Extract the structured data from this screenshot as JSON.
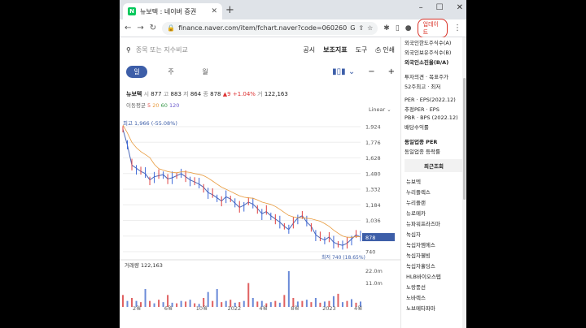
{
  "browser": {
    "tab_title": "뉴보텍 : 네이버 증권",
    "tab_favicon": "N",
    "url": "finance.naver.com/item/fchart.naver?code=060260",
    "update_label": "업데이트"
  },
  "search": {
    "placeholder": "종목 또는 지수비교"
  },
  "menu": [
    "공시",
    "보조지표",
    "도구",
    "인쇄"
  ],
  "periods": [
    "일",
    "주",
    "월"
  ],
  "quote": {
    "name": "뉴보텍",
    "open_label": "시",
    "open": "877",
    "high_label": "고",
    "high": "883",
    "low_label": "저",
    "low": "864",
    "close_label": "종",
    "close": "878",
    "change": "▲9",
    "change_pct": "+1.04%",
    "volume_label": "거",
    "volume": "122,163"
  },
  "ma": {
    "label": "이동평균",
    "m5": "5",
    "m20": "20",
    "m60": "60",
    "m120": "120"
  },
  "scale": "Linear",
  "annotations": {
    "high": "최고 1,966 (-55.08%)",
    "low": "최저 740 (18.65%)",
    "current": "878"
  },
  "volume_panel": {
    "label": "거래량",
    "value": "122,163"
  },
  "chart_data": {
    "type": "line",
    "price_ticks": [
      "1,924",
      "1,776",
      "1,628",
      "1,480",
      "1,332",
      "1,184",
      "1,036",
      "888",
      "740"
    ],
    "volume_ticks": [
      "22.0m",
      "11.0m"
    ],
    "x_ticks": [
      "2월",
      "6월",
      "10월",
      "2022",
      "4월",
      "8월",
      "2023",
      "4월"
    ],
    "series": [
      {
        "name": "종가",
        "values": [
          1900,
          1750,
          1560,
          1530,
          1500,
          1480,
          1420,
          1450,
          1460,
          1470,
          1430,
          1440,
          1460,
          1480,
          1450,
          1420,
          1400,
          1380,
          1350,
          1300,
          1280,
          1250,
          1220,
          1260,
          1240,
          1200,
          1160,
          1180,
          1210,
          1190,
          1150,
          1100,
          1120,
          1080,
          1050,
          1020,
          980,
          950,
          1010,
          1060,
          1080,
          1020,
          980,
          900,
          870,
          850,
          880,
          830,
          810,
          800,
          820,
          860,
          900,
          878
        ]
      }
    ],
    "volume": [
      2,
      1,
      1.5,
      1,
      0.8,
      3,
      1,
      0.6,
      1.2,
      0.8,
      2,
      0.7,
      0.6,
      1,
      0.9,
      1.2,
      0.6,
      0.5,
      1.5,
      2.5,
      1,
      3,
      0.8,
      1,
      1.2,
      0.7,
      0.8,
      1,
      4,
      1.5,
      0.9,
      1,
      0.6,
      0.8,
      1,
      0.7,
      2,
      6,
      1.5,
      0.9,
      1,
      1.2,
      0.8,
      1.5,
      0.7,
      0.9,
      1,
      1.8,
      2.2,
      0.8,
      1,
      1.3,
      0.7,
      0.9
    ]
  },
  "sidebar": {
    "lines": [
      "외국인한도주식수(A)",
      "외국인보유주식수(B)",
      "외국인소진율(B/A)",
      "투자의견 · 목표주가",
      "52주최고 · 최저",
      "PER · EPS(2022.12)",
      "추정PER · EPS",
      "PBR · BPS (2022.12)",
      "배당수익률",
      "동일업종 PER",
      "동일업종 등락률"
    ],
    "recent_label": "최근조회",
    "recent": [
      "뉴보텍",
      "누리플렉스",
      "누리플랜",
      "뉴로메카",
      "뉴파워프라즈마",
      "녹십자",
      "녹십자엠에스",
      "녹십자웰빙",
      "녹십자홀딩스",
      "HLB바이오스텝",
      "노랑풍선",
      "노바렉스",
      "노브메타파마"
    ]
  }
}
